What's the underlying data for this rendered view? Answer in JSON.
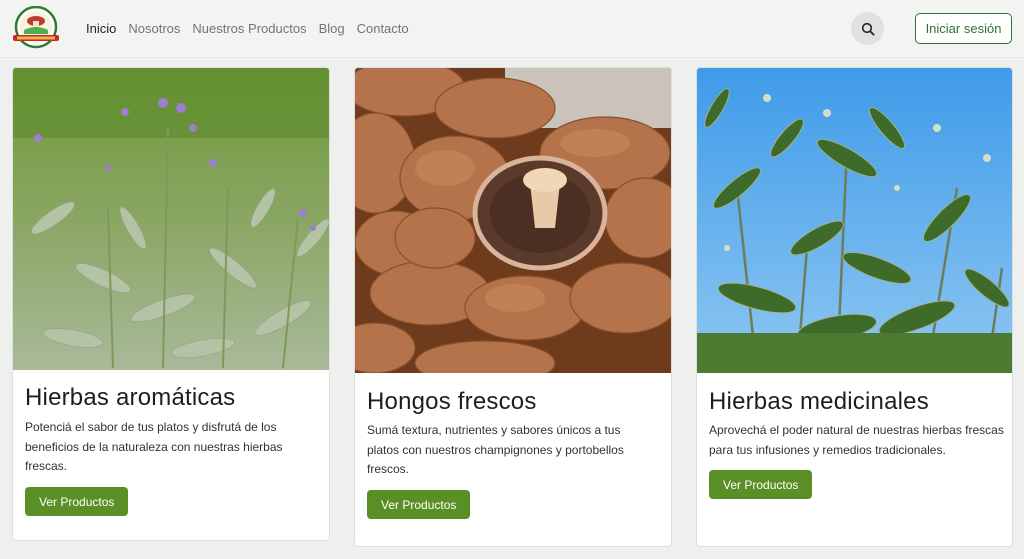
{
  "nav": {
    "links": [
      {
        "label": "Inicio",
        "active": true
      },
      {
        "label": "Nosotros",
        "active": false
      },
      {
        "label": "Nuestros Productos",
        "active": false
      },
      {
        "label": "Blog",
        "active": false
      },
      {
        "label": "Contacto",
        "active": false
      }
    ],
    "search_icon": "search-icon",
    "login_label": "Iniciar sesión"
  },
  "cards": [
    {
      "title": "Hierbas aromáticas",
      "text": "Potenciá el sabor de tus platos y disfrutá de los beneficios de la naturaleza con nuestras hierbas frescas.",
      "button": "Ver Productos"
    },
    {
      "title": "Hongos frescos",
      "text": "Sumá textura, nutrientes y sabores únicos a tus platos con nuestros champignones y portobellos frescos.",
      "button": "Ver Productos"
    },
    {
      "title": "Hierbas medicinales",
      "text": "Aprovechá el poder natural de nuestras hierbas frescas para tus infusiones y remedios tradicionales.",
      "button": "Ver Productos"
    }
  ],
  "colors": {
    "accent_green": "#5a8f25",
    "login_border": "#2f6f3a",
    "background": "#eef0ee"
  }
}
